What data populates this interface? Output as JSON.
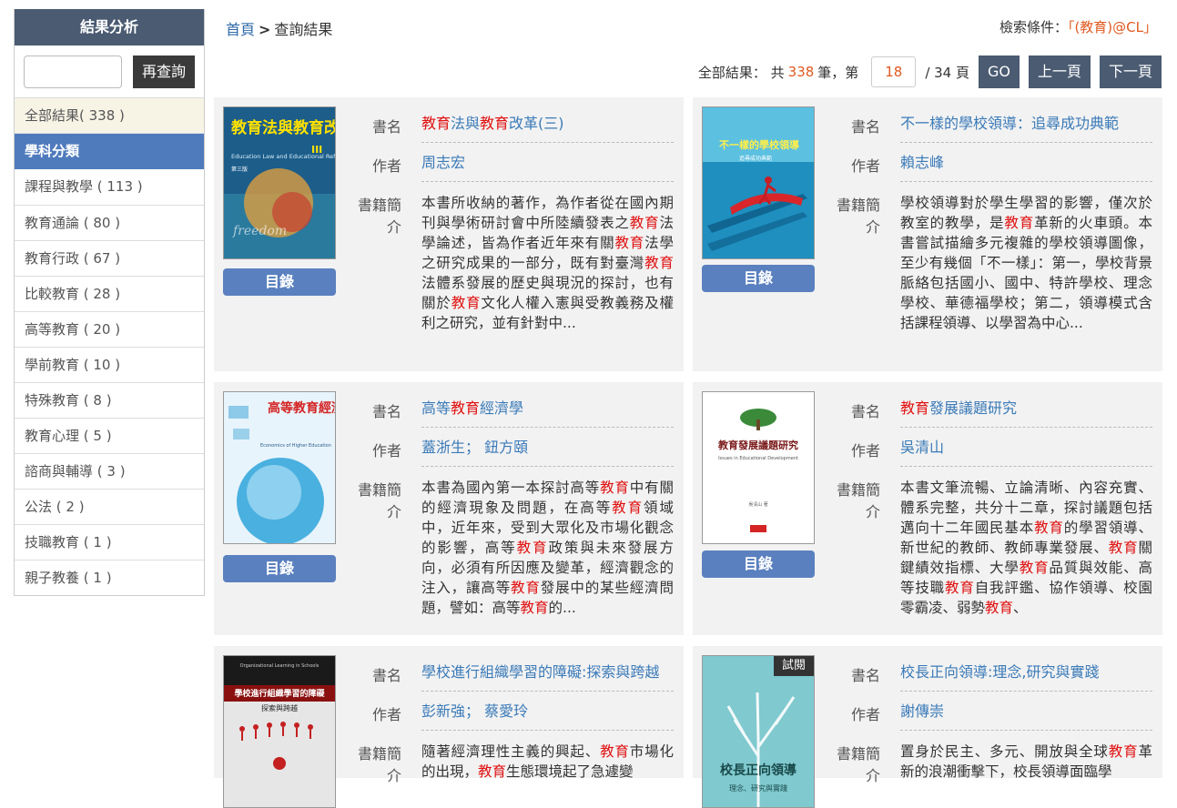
{
  "sidebar": {
    "title": "結果分析",
    "search_button": "再查詢",
    "all_results": "全部結果( 338 )",
    "category_header": "學科分類",
    "categories": [
      "課程與教學 ( 113 )",
      "教育通論 ( 80 )",
      "教育行政 ( 67 )",
      "比較教育 ( 28 )",
      "高等教育 ( 20 )",
      "學前教育 ( 10 )",
      "特殊教育 ( 8 )",
      "教育心理 ( 5 )",
      "諮商與輔導 ( 3 )",
      "公法 ( 2 )",
      "技職教育 ( 1 )",
      "親子教養 ( 1 )"
    ]
  },
  "breadcrumb": {
    "home": "首頁",
    "sep": ">",
    "current": "查詢結果"
  },
  "search_condition": {
    "label": "檢索條件：",
    "query": "「(教育)@CL」"
  },
  "pager": {
    "prefix": "全部結果：  共",
    "total": "338",
    "mid": "筆，第",
    "page": "18",
    "suffix": "/ 34 頁",
    "go": "GO",
    "prev": "上一頁",
    "next": "下一頁"
  },
  "labels": {
    "title": "書名",
    "author": "作者",
    "intro": "書籍簡介",
    "toc": "目錄",
    "preview": "試閱"
  },
  "colors": {
    "header_bg": "#4a5b72",
    "category_bg": "#4f7bbd",
    "link": "#3a7ab8",
    "highlight": "#e01010",
    "toc_button": "#5a80bf"
  },
  "books": [
    {
      "title_parts": [
        [
          "教育",
          true
        ],
        [
          "法與",
          false
        ],
        [
          "教育",
          true
        ],
        [
          "改革(三)",
          false
        ]
      ],
      "author": "周志宏",
      "intro_parts": [
        [
          "本書所收納的著作，為作者從在國內期刊與學術研討會中所陸續發表之",
          false
        ],
        [
          "教育",
          true
        ],
        [
          "法學論述，皆為作者近年來有關",
          false
        ],
        [
          "教育",
          true
        ],
        [
          "法學之研究成果的一部分，既有對臺灣",
          false
        ],
        [
          "教育",
          true
        ],
        [
          "法體系發展的歷史與現況的探討，也有關於",
          false
        ],
        [
          "教育",
          true
        ],
        [
          "文化人權入憲與受教義務及權利之研究，並有針對中...",
          false
        ]
      ],
      "cover": {
        "title": "教育法與教育改革",
        "subtitle": "Education Law and Educational Reform",
        "num": "III",
        "sub2": "第三版"
      }
    },
    {
      "title_parts": [
        [
          "不一樣的學校領導：追尋成功典範",
          false
        ]
      ],
      "author": "賴志峰",
      "intro_parts": [
        [
          "學校領導對於學生學習的影響，僅次於教室的教學，是",
          false
        ],
        [
          "教育",
          true
        ],
        [
          "革新的火車頭。本書嘗試描繪多元複雜的學校領導圖像，至少有幾個「不一樣」：第一，學校背景脈絡包括國小、國中、特許學校、理念學校、華德福學校；第二，領導模式含括課程領導、以學習為中心...",
          false
        ]
      ],
      "cover": {
        "title": "不一樣的學校領導",
        "subtitle": "追尋成功典範"
      }
    },
    {
      "title_parts": [
        [
          "高等",
          false
        ],
        [
          "教育",
          true
        ],
        [
          "經濟學",
          false
        ]
      ],
      "author": "蓋浙生；  鈕方頤",
      "intro_parts": [
        [
          "本書為國內第一本探討高等",
          false
        ],
        [
          "教育",
          true
        ],
        [
          "中有關的經濟現象及問題，在高等",
          false
        ],
        [
          "教育",
          true
        ],
        [
          "領域中，近年來，受到大眾化及市場化觀念的影響，高等",
          false
        ],
        [
          "教育",
          true
        ],
        [
          "政策與未來發展方向，必須有所因應及變革，經濟觀念的注入，讓高等",
          false
        ],
        [
          "教育",
          true
        ],
        [
          "發展中的某些經濟問題，譬如：高等",
          false
        ],
        [
          "教育",
          true
        ],
        [
          "的...",
          false
        ]
      ],
      "cover": {
        "title": "高等教育經濟學",
        "subtitle": "Economics of Higher Education"
      }
    },
    {
      "title_parts": [
        [
          "教育",
          true
        ],
        [
          "發展議題研究",
          false
        ]
      ],
      "author": "吳清山",
      "intro_parts": [
        [
          "本書文筆流暢、立論清晰、內容充實、體系完整，共分十二章，探討議題包括邁向十二年國民基本",
          false
        ],
        [
          "教育",
          true
        ],
        [
          "的學習領導、新世紀的教師、教師專業發展、",
          false
        ],
        [
          "教育",
          true
        ],
        [
          "關鍵績效指標、大學",
          false
        ],
        [
          "教育",
          true
        ],
        [
          "品質與效能、高等技職",
          false
        ],
        [
          "教育",
          true
        ],
        [
          "自我評鑑、協作領導、校園零霸凌、弱勢",
          false
        ],
        [
          "教育",
          true
        ],
        [
          "、",
          false
        ]
      ],
      "cover": {
        "title": "教育發展議題研究",
        "subtitle": "Issues in Educational Development",
        "author_line": "吳清山 著"
      }
    },
    {
      "title_parts": [
        [
          "學校進行組織學習的障礙:探索與跨越",
          false
        ]
      ],
      "author": "彭新強；  蔡愛玲",
      "intro_parts": [
        [
          "隨著經濟理性主義的興起、",
          false
        ],
        [
          "教育",
          true
        ],
        [
          "市場化的出現，",
          false
        ],
        [
          "教育",
          true
        ],
        [
          "生態環境起了急遽變",
          false
        ]
      ],
      "cover": {
        "title": "學校進行組織學習的障礙",
        "subtitle": "探索與跨越",
        "en": "Organizational Learning in Schools"
      }
    },
    {
      "title_parts": [
        [
          "校長正向領導:理念,研究與實踐",
          false
        ]
      ],
      "author": "謝傳崇",
      "intro_parts": [
        [
          "置身於民主、多元、開放與全球",
          false
        ],
        [
          "教育",
          true
        ],
        [
          "革新的浪潮衝擊下，校長領導面臨學",
          false
        ]
      ],
      "cover": {
        "title": "校長正向領導",
        "subtitle": "理念、研究與實踐"
      }
    }
  ]
}
